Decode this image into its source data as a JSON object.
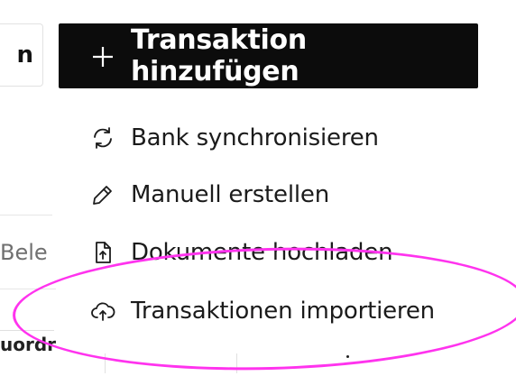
{
  "background": {
    "left_button_text": "n",
    "field_text": "Bele",
    "column_header": "uordr"
  },
  "primary_button": {
    "label": "Transaktion hinzufügen",
    "icon": "plus-icon"
  },
  "menu": {
    "items": [
      {
        "label": "Bank synchronisieren",
        "icon": "sync-icon"
      },
      {
        "label": "Manuell erstellen",
        "icon": "pencil-icon"
      },
      {
        "label": "Dokumente hochladen",
        "icon": "file-upload-icon"
      },
      {
        "label": "Transaktionen importieren",
        "icon": "cloud-upload-icon"
      }
    ]
  },
  "colors": {
    "primary_bg": "#0c0c0c",
    "annotation": "#ff33ee"
  }
}
